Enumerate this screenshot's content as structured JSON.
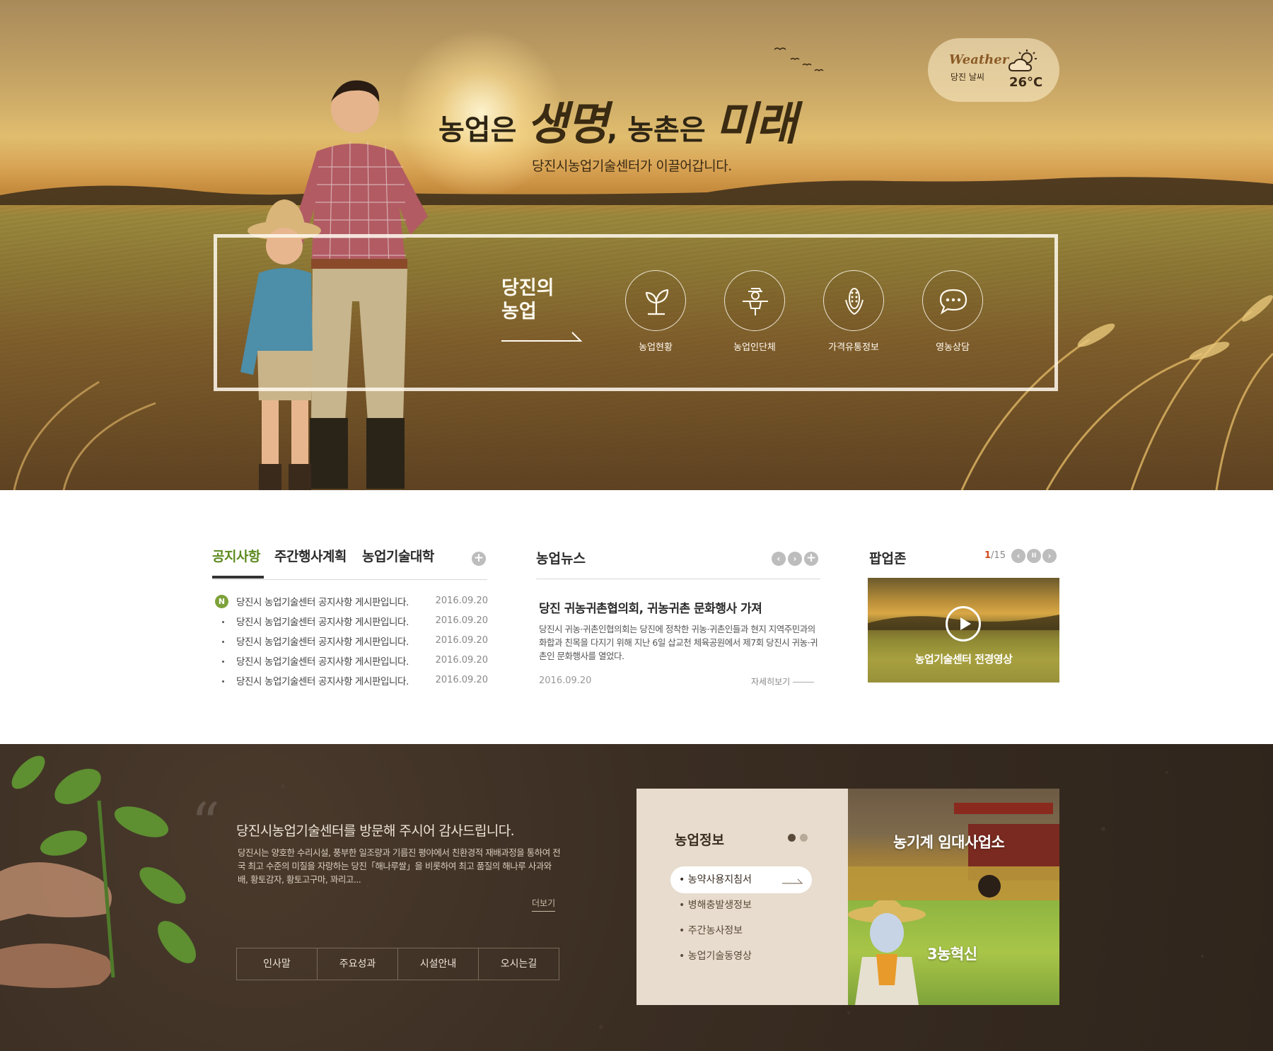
{
  "hero": {
    "weather": {
      "title": "Weather",
      "city": "당진 날씨",
      "temperature": "26°C",
      "icon": "partly-cloudy-icon"
    },
    "headline_part1": "농업은 ",
    "headline_word1": "생명",
    "headline_part2": ", 농촌은 ",
    "headline_word2": "미래",
    "subtitle": "당진시농업기술센터가 이끌어갑니다.",
    "quick_title": "당진의\n농업",
    "quick_links": [
      {
        "label": "농업현황",
        "icon": "sprout-icon"
      },
      {
        "label": "농업인단체",
        "icon": "scarecrow-icon"
      },
      {
        "label": "가격유통정보",
        "icon": "corn-icon"
      },
      {
        "label": "영농상담",
        "icon": "chat-bubble-icon"
      }
    ]
  },
  "notice": {
    "tabs": [
      "공지사항",
      "주간행사계획",
      "농업기술대학"
    ],
    "more": "+",
    "new_badge": "N",
    "items": [
      {
        "title": "당진시 농업기술센터 공지사항 게시판입니다.",
        "date": "2016.09.20",
        "is_new": true
      },
      {
        "title": "당진시 농업기술센터 공지사항 게시판입니다.",
        "date": "2016.09.20",
        "is_new": false
      },
      {
        "title": "당진시 농업기술센터 공지사항 게시판입니다.",
        "date": "2016.09.20",
        "is_new": false
      },
      {
        "title": "당진시 농업기술센터 공지사항 게시판입니다.",
        "date": "2016.09.20",
        "is_new": false
      },
      {
        "title": "당진시 농업기술센터 공지사항 게시판입니다.",
        "date": "2016.09.20",
        "is_new": false
      }
    ]
  },
  "news": {
    "title": "농업뉴스",
    "prev": "‹",
    "next": "›",
    "more": "+",
    "headline": "당진 귀농귀촌협의회, 귀농귀촌 문화행사 가져",
    "body": "당진시 귀농·귀촌인협의회는 당진에 정착한 귀농·귀촌인들과 현지 지역주민과의 화합과 친목을 다지기 위해 지난 6일 삽교천 체육공원에서 제7회 당진시 귀농·귀촌인 문화행사를 열었다.",
    "date": "2016.09.20",
    "more_label": "자세히보기"
  },
  "popup": {
    "title": "팝업존",
    "page_current": "1",
    "page_total": "/15",
    "prev": "‹",
    "pause": "II",
    "next": "›",
    "caption": "농업기술센터 전경영상"
  },
  "welcome": {
    "quote_mark": "“",
    "title": "당진시농업기술센터를 방문해 주시어 감사드립니다.",
    "body": "당진시는 양호한 수리시설, 풍부한 일조량과 기름진 평야에서 친환경적 재배과정을 통하여 전국 최고 수준의 미질을 자랑하는 당진「해나루쌀」을 비롯하여 최고 품질의 해나루 사과와 배, 황토감자, 황토고구마, 꽈리고...",
    "more": "더보기",
    "nav": [
      "인사말",
      "주요성과",
      "시설안내",
      "오시는길"
    ]
  },
  "info": {
    "title": "농업정보",
    "items": [
      "농약사용지침서",
      "병해충발생정보",
      "주간농사정보",
      "농업기술동영상"
    ],
    "services": [
      "농기계 임대사업소",
      "3농혁신"
    ]
  },
  "colors": {
    "accent_green": "#5d8a1f",
    "badge_green": "#7ea23a",
    "page_red": "#d24a1f",
    "soil_brown": "#3a2d22",
    "panel_beige": "#e7dccd"
  }
}
